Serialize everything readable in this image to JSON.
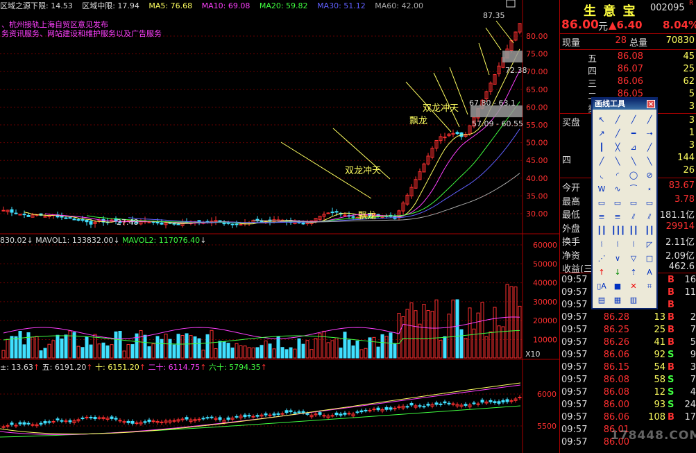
{
  "indicator_line": {
    "lower_label": "区域之源下限: 14.53",
    "mid_label": "区域中限: 17.94",
    "ma5": "MA5: 76.68",
    "ma10": "MA10: 69.08",
    "ma20": "MA20: 59.82",
    "ma30": "MA30: 51.12",
    "ma60": "MA60: 42.00"
  },
  "news1": "、杭州接轨上海自贸区意见发布",
  "news2": "务资讯服务、网站建设和维护服务以及广告服务",
  "annotations": {
    "high": "87.35",
    "low": "27.48",
    "p72": "72.38",
    "band1": "67.80 - 63.1",
    "band2": "57.09 - 60.55",
    "dragon1": "双龙冲天",
    "dragon2": "双龙冲天",
    "piao1": "飘龙",
    "piao2": "飘龙"
  },
  "price_axis": [
    "80.00",
    "75.00",
    "70.00",
    "65.00",
    "60.00",
    "55.00",
    "50.00",
    "45.00",
    "40.00",
    "35.00",
    "30.00"
  ],
  "vol_header": {
    "vol": "830.02",
    "mavol1": "MAVOL1: 133832.00",
    "mavol2": "MAVOL2: 117076.40"
  },
  "vol_axis": [
    "60000",
    "50000",
    "40000",
    "30000",
    "20000",
    "10000"
  ],
  "vol_unit": "X10",
  "idx_header": {
    "a": "±: 13.63",
    "b": "五: 6191.20",
    "c": "十: 6151.20",
    "d": "二十: 6114.75",
    "e": "六十: 5794.35"
  },
  "idx_axis": [
    "6000",
    "5500"
  ],
  "quote": {
    "name": "生 意 宝",
    "code": "002095",
    "r": "R",
    "price": "86.00",
    "unit": "元",
    "change": "▲6.40",
    "pct": "8.04%",
    "now_label": "现量",
    "now_val": "28",
    "total_label": "总量",
    "total_val": "70830",
    "asks": [
      {
        "l": "五",
        "p": "86.08",
        "v": "45"
      },
      {
        "l": "四",
        "p": "86.07",
        "v": "25"
      },
      {
        "l": "三",
        "p": "86.06",
        "v": "62"
      },
      {
        "l": "二",
        "p": "86.05",
        "v": "5"
      },
      {
        "l": "卖盘",
        "p": "",
        "v": "3"
      }
    ],
    "bids": [
      {
        "l": "买盘",
        "p": "",
        "v": "3"
      },
      {
        "l": "",
        "p": "",
        "v": "1"
      },
      {
        "l": "",
        "p": "",
        "v": "3"
      },
      {
        "l": "四",
        "p": "",
        "v": "144"
      },
      {
        "l": "",
        "p": "",
        "v": "26"
      }
    ],
    "stats": [
      {
        "l": "今开",
        "v": "83.67",
        "c": "#ff3030"
      },
      {
        "l": "最高",
        "v": "3.78",
        "c": "#ff3030"
      },
      {
        "l": "最低",
        "v": "181.1亿",
        "c": "#ddd"
      },
      {
        "l": "外盘",
        "v": "29914",
        "c": "#ff3030"
      },
      {
        "l": "换手",
        "v": "2.11亿",
        "c": "#ddd"
      },
      {
        "l": "净资",
        "v": "2.09亿",
        "c": "#ddd"
      },
      {
        "l": "收益(三)",
        "v": "462.6",
        "c": "#ddd"
      }
    ],
    "ticks": [
      {
        "t": "09:57",
        "p": "",
        "v": "",
        "s": "B",
        "n": "16"
      },
      {
        "t": "09:57",
        "p": "",
        "v": "",
        "s": "B",
        "n": "11"
      },
      {
        "t": "09:57",
        "p": "",
        "v": "",
        "s": "B",
        "n": ""
      },
      {
        "t": "09:57",
        "p": "86.28",
        "v": "13",
        "s": "B",
        "n": "2"
      },
      {
        "t": "09:57",
        "p": "86.25",
        "v": "25",
        "s": "B",
        "n": "7"
      },
      {
        "t": "09:57",
        "p": "86.26",
        "v": "41",
        "s": "B",
        "n": "5"
      },
      {
        "t": "09:57",
        "p": "86.06",
        "v": "92",
        "s": "S",
        "n": "9"
      },
      {
        "t": "09:57",
        "p": "86.15",
        "v": "54",
        "s": "B",
        "n": "3"
      },
      {
        "t": "09:57",
        "p": "86.08",
        "v": "58",
        "s": "S",
        "n": "7"
      },
      {
        "t": "09:57",
        "p": "86.08",
        "v": "12",
        "s": "S",
        "n": "4"
      },
      {
        "t": "09:57",
        "p": "86.00",
        "v": "93",
        "s": "S",
        "n": "24"
      },
      {
        "t": "09:57",
        "p": "86.06",
        "v": "108",
        "s": "B",
        "n": "17"
      },
      {
        "t": "09:57",
        "p": "86.01",
        "v": "",
        "s": "",
        "n": ""
      },
      {
        "t": "09:57",
        "p": "86.00",
        "v": "",
        "s": "",
        "n": ""
      }
    ]
  },
  "tool": {
    "title": "画线工具",
    "close": "×"
  },
  "watermark": "178448.COM"
}
